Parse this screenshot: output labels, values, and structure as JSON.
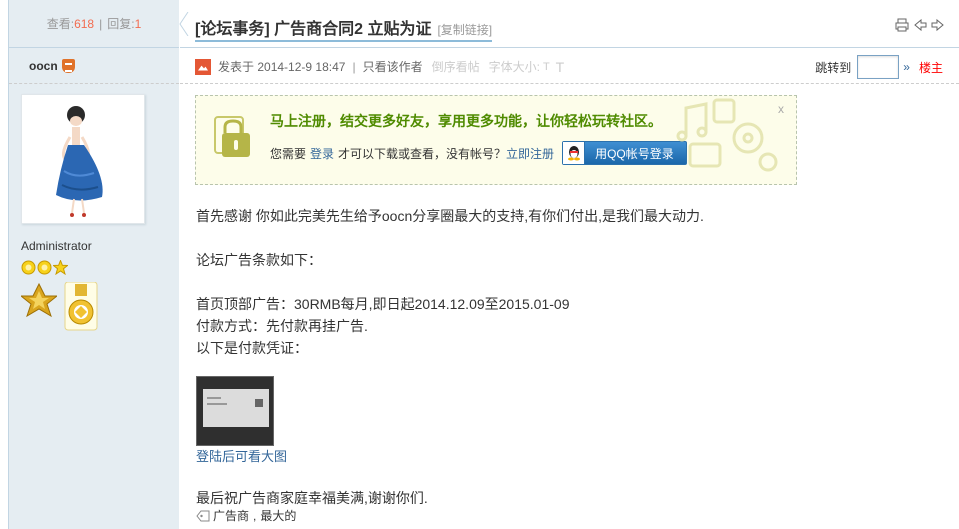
{
  "stats": {
    "views_label": "查看:",
    "views": "618",
    "replies_label": "回复:",
    "replies": "1"
  },
  "thread": {
    "title": "[论坛事务] 广告商合同2 立贴为证",
    "copy_link": "[复制链接]"
  },
  "author": {
    "name": "oocn",
    "role": "Administrator"
  },
  "meta": {
    "posted_prefix": "发表于",
    "posted_time": "2014-12-9 18:47",
    "separator": "|",
    "only_author": "只看该作者",
    "reverse_order": "倒序看帖",
    "font_size": "字体大小:",
    "font_size_t": "T",
    "font_size_T": "T",
    "jump_label": "跳转到",
    "jump_arrow": "»",
    "floor": "楼主"
  },
  "register_box": {
    "headline": "马上注册，结交更多好友，享用更多功能，让你轻松玩转社区。",
    "need_prefix": "您需要",
    "login_link": "登录",
    "need_mid": "才可以下载或查看，没有帐号？",
    "register_link": "立即注册",
    "qq_button": "用QQ帐号登录",
    "close": "x"
  },
  "post": {
    "line1": "首先感谢 你如此完美先生给予oocn分享圈最大的支持,有你们付出,是我们最大动力.",
    "line2": "论坛广告条款如下：",
    "line3": "首页顶部广告：30RMB每月,即日起2014.12.09至2015.01-09",
    "line4": "付款方式：先付款再挂广告.",
    "line5": "以下是付款凭证：",
    "view_large": "登陆后可看大图",
    "closing": "最后祝广告商家庭幸福美满,谢谢你们."
  },
  "tags": [
    "广告商",
    "最大的"
  ],
  "tag_separator": ",",
  "colors": {
    "sidebar_bg": "#e5edf2",
    "border": "#c2d5e3",
    "link": "#336699",
    "accent_red": "#f26c4f",
    "register_green": "#4f8b00"
  }
}
